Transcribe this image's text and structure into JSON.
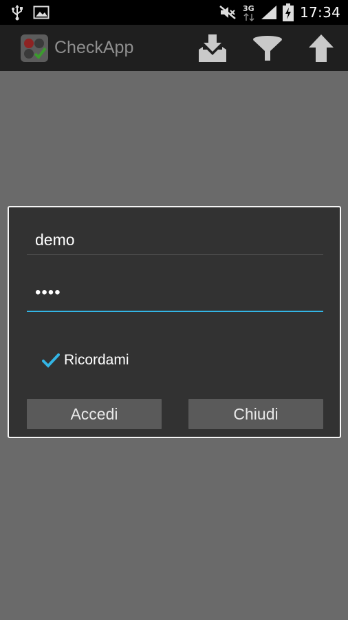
{
  "status_bar": {
    "time": "17:34",
    "network": "3G",
    "icons": [
      "usb-icon",
      "image-icon",
      "mute-icon",
      "network-3g-icon",
      "signal-icon",
      "battery-charging-icon"
    ]
  },
  "action_bar": {
    "app_title": "CheckApp",
    "actions": [
      "download-icon",
      "filter-icon",
      "upload-icon"
    ]
  },
  "login_dialog": {
    "username_value": "demo",
    "password_value": "••••",
    "remember_label": "Ricordami",
    "remember_checked": true,
    "login_button": "Accedi",
    "close_button": "Chiudi"
  },
  "colors": {
    "accent": "#33b5e5",
    "dialog_bg": "#323232",
    "screen_bg": "#6a6a6a",
    "button_bg": "#5a5a5a"
  }
}
